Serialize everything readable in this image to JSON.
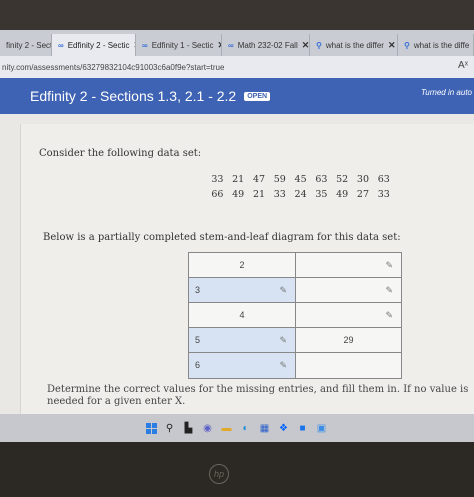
{
  "browser": {
    "tabs": [
      {
        "label": "finity 2 - Sectic",
        "icon": "infinity-icon"
      },
      {
        "label": "Edfinity 2 - Sectic",
        "icon": "infinity-icon"
      },
      {
        "label": "Edfinity 1 - Sectic",
        "icon": "infinity-icon"
      },
      {
        "label": "Math 232-02 Fall",
        "icon": "infinity-icon"
      },
      {
        "label": "what is the differ",
        "icon": "search-icon"
      },
      {
        "label": "what is the diffe",
        "icon": "search-icon"
      }
    ],
    "url": "nity.com/assessments/63279832104c91003c6a0f9e?start=true",
    "reader_label": "Aˣ"
  },
  "header": {
    "title": "Edfinity 2 - Sections 1.3, 2.1 - 2.2",
    "badge": "OPEN",
    "status": "Turned in auto"
  },
  "problem": {
    "intro": "Consider the following data set:",
    "data_rows": [
      [
        "33",
        "21",
        "47",
        "59",
        "45",
        "63",
        "52",
        "30",
        "63"
      ],
      [
        "66",
        "49",
        "21",
        "33",
        "24",
        "35",
        "49",
        "27",
        "33"
      ]
    ],
    "stem_leaf_intro": "Below is a partially completed stem-and-leaf diagram for this data set:",
    "table": [
      {
        "stem": "2",
        "stem_is_input": false,
        "leaf": "",
        "leaf_is_input": false
      },
      {
        "stem": "3",
        "stem_is_input": true,
        "leaf": "",
        "leaf_is_input": false
      },
      {
        "stem": "4",
        "stem_is_input": false,
        "leaf": "",
        "leaf_is_input": false
      },
      {
        "stem": "5",
        "stem_is_input": true,
        "leaf": "29",
        "leaf_is_input": false
      },
      {
        "stem": "6",
        "stem_is_input": true,
        "leaf": "",
        "leaf_is_input": false
      }
    ],
    "instructions": "Determine the correct values for the missing entries, and fill them in. If no value is needed for a given enter X."
  },
  "taskbar": {
    "icons": [
      "windows-icon",
      "search-icon",
      "file-icon",
      "chat-icon",
      "folder-icon",
      "edge-icon",
      "store-icon",
      "dropbox-icon",
      "app-icon",
      "photos-icon"
    ]
  },
  "bezel": {
    "logo": "hp"
  },
  "colors": {
    "header_blue": "#3e63b4",
    "input_fill": "#d7e3f3"
  }
}
